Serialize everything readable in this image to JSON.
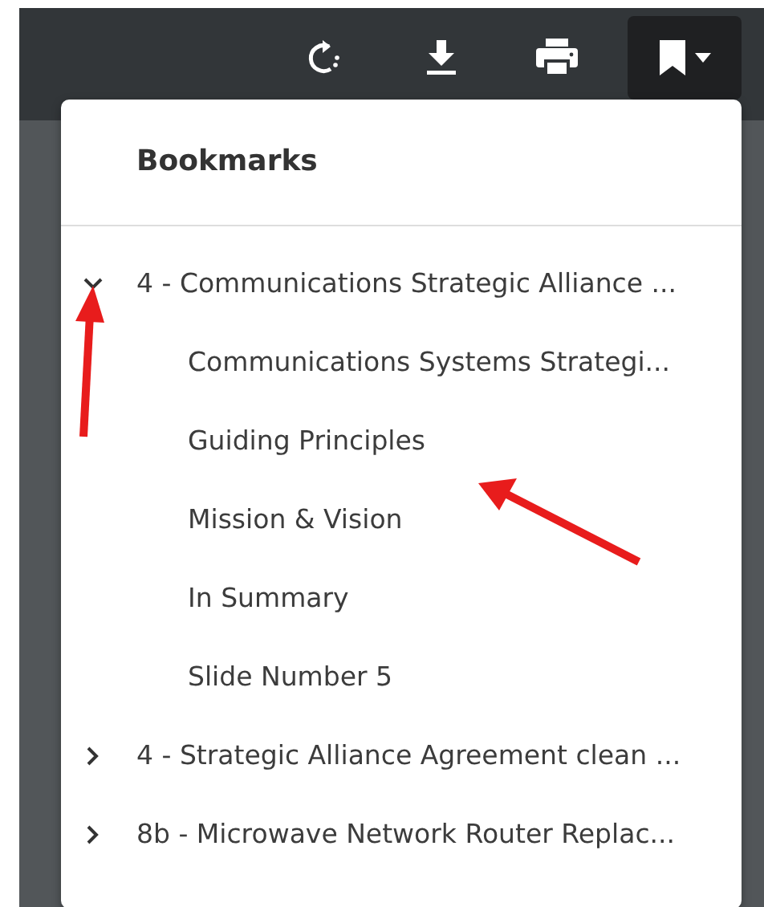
{
  "toolbar": {
    "buttons": [
      {
        "kind": "rotate"
      },
      {
        "kind": "download"
      },
      {
        "kind": "print"
      },
      {
        "kind": "bookmark",
        "selected": true
      }
    ]
  },
  "bookmarks": {
    "title": "Bookmarks",
    "items": [
      {
        "label": "4 - Communications Strategic Alliance ...",
        "expanded": true,
        "children": [
          {
            "label": "Communications Systems Strategi..."
          },
          {
            "label": "Guiding Principles"
          },
          {
            "label": "Mission & Vision"
          },
          {
            "label": "In Summary"
          },
          {
            "label": "Slide Number 5"
          }
        ]
      },
      {
        "label": "4 - Strategic Alliance Agreement clean ...",
        "expanded": false
      },
      {
        "label": "8b - Microwave Network Router Replac...",
        "expanded": false
      }
    ]
  }
}
